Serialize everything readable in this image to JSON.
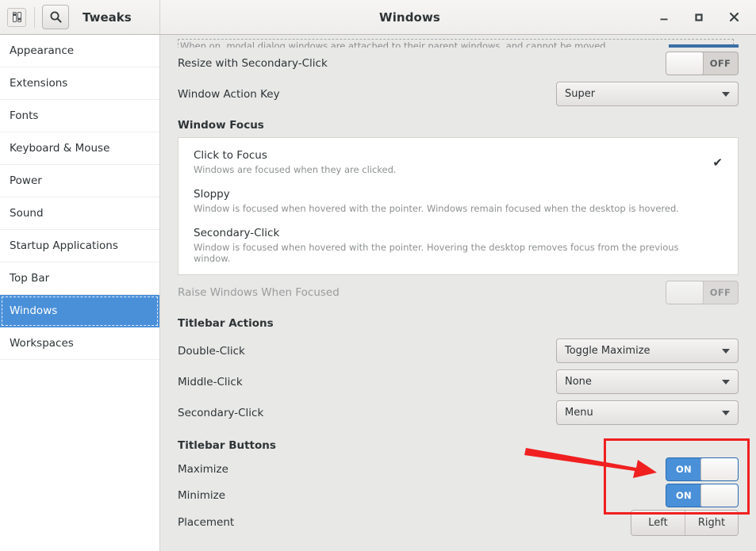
{
  "window": {
    "title": "Windows",
    "app_name": "Tweaks",
    "icon": "tweaks-app-icon",
    "controls": {
      "minimize": "–",
      "maximize": "□",
      "close": "✕"
    },
    "search_icon": "search-icon"
  },
  "sidebar": {
    "items": [
      {
        "label": "Appearance",
        "selected": false
      },
      {
        "label": "Extensions",
        "selected": false
      },
      {
        "label": "Fonts",
        "selected": false
      },
      {
        "label": "Keyboard & Mouse",
        "selected": false
      },
      {
        "label": "Power",
        "selected": false
      },
      {
        "label": "Sound",
        "selected": false
      },
      {
        "label": "Startup Applications",
        "selected": false
      },
      {
        "label": "Top Bar",
        "selected": false
      },
      {
        "label": "Windows",
        "selected": true
      },
      {
        "label": "Workspaces",
        "selected": false
      }
    ]
  },
  "content": {
    "clipped_description": "When on, modal dialog windows are attached to their parent windows, and cannot be moved.",
    "resize_secondary_click": {
      "label": "Resize with Secondary-Click",
      "state": "OFF"
    },
    "window_action_key": {
      "label": "Window Action Key",
      "value": "Super"
    },
    "window_focus": {
      "heading": "Window Focus",
      "options": [
        {
          "title": "Click to Focus",
          "description": "Windows are focused when they are clicked.",
          "checked": true,
          "check_glyph": "✔"
        },
        {
          "title": "Sloppy",
          "description": "Window is focused when hovered with the pointer. Windows remain focused when the desktop is hovered.",
          "checked": false,
          "check_glyph": ""
        },
        {
          "title": "Secondary-Click",
          "description": "Window is focused when hovered with the pointer. Hovering the desktop removes focus from the previous window.",
          "checked": false,
          "check_glyph": ""
        }
      ]
    },
    "raise_windows_when_focused": {
      "label": "Raise Windows When Focused",
      "state": "OFF",
      "disabled": true
    },
    "titlebar_actions": {
      "heading": "Titlebar Actions",
      "rows": [
        {
          "label": "Double-Click",
          "value": "Toggle Maximize"
        },
        {
          "label": "Middle-Click",
          "value": "None"
        },
        {
          "label": "Secondary-Click",
          "value": "Menu"
        }
      ]
    },
    "titlebar_buttons": {
      "heading": "Titlebar Buttons",
      "maximize": {
        "label": "Maximize",
        "state": "ON"
      },
      "minimize": {
        "label": "Minimize",
        "state": "ON"
      },
      "placement": {
        "label": "Placement",
        "options": [
          {
            "label": "Left",
            "selected": false
          },
          {
            "label": "Right",
            "selected": false
          }
        ]
      }
    }
  },
  "annotations": {
    "highlight_color": "#f02020",
    "box_target": "titlebar-buttons-toggles",
    "arrow": "points-right-to-toggles"
  },
  "colors": {
    "accent": "#4a90d9",
    "selection": "#4a90d9",
    "window_bg": "#e8e8e7",
    "sidebar_bg": "#ffffff",
    "annotation": "#f02020"
  }
}
